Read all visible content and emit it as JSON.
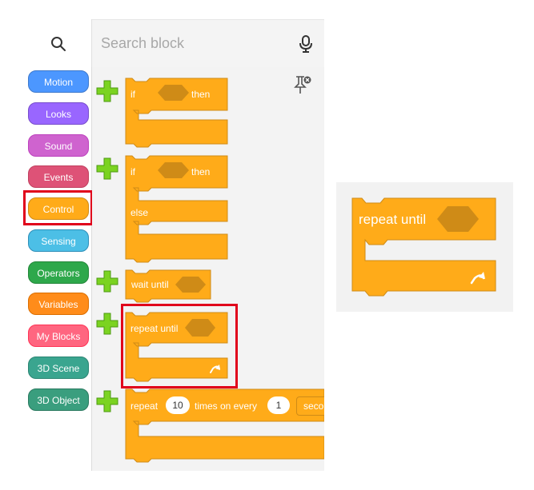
{
  "search": {
    "placeholder": "Search block"
  },
  "categories": [
    {
      "label": "Motion",
      "color": "#4c97ff",
      "border": "#3d79cc"
    },
    {
      "label": "Looks",
      "color": "#9966ff",
      "border": "#774dcb"
    },
    {
      "label": "Sound",
      "color": "#cf63cf",
      "border": "#bd42bd"
    },
    {
      "label": "Events",
      "color": "#de5277",
      "border": "#c0405f"
    },
    {
      "label": "Control",
      "color": "#ffab19",
      "border": "#cf8b17"
    },
    {
      "label": "Sensing",
      "color": "#4cbfe6",
      "border": "#2e8eb8"
    },
    {
      "label": "Operators",
      "color": "#2ea84b",
      "border": "#238639"
    },
    {
      "label": "Variables",
      "color": "#ff8c1a",
      "border": "#db6e00"
    },
    {
      "label": "My Blocks",
      "color": "#ff6680",
      "border": "#ff3355"
    },
    {
      "label": "3D Scene",
      "color": "#3aa58f",
      "border": "#2c8573"
    },
    {
      "label": "3D Object",
      "color": "#3a9e7e",
      "border": "#2b7a60"
    }
  ],
  "selected_category": "Control",
  "blocks": {
    "if_then": {
      "if": "if",
      "then": "then"
    },
    "if_else": {
      "if": "if",
      "then": "then",
      "else": "else"
    },
    "wait_until": {
      "label": "wait until"
    },
    "repeat_until": {
      "label": "repeat until"
    },
    "repeat_every": {
      "repeat": "repeat",
      "count": "10",
      "times_on_every": "times on every",
      "interval": "1",
      "unit": "seco"
    }
  },
  "preview": {
    "label": "repeat until"
  },
  "colors": {
    "control": "#ffab19",
    "control_dark": "#cf8b17",
    "highlight": "#e0001b",
    "add": "#7bd321"
  }
}
